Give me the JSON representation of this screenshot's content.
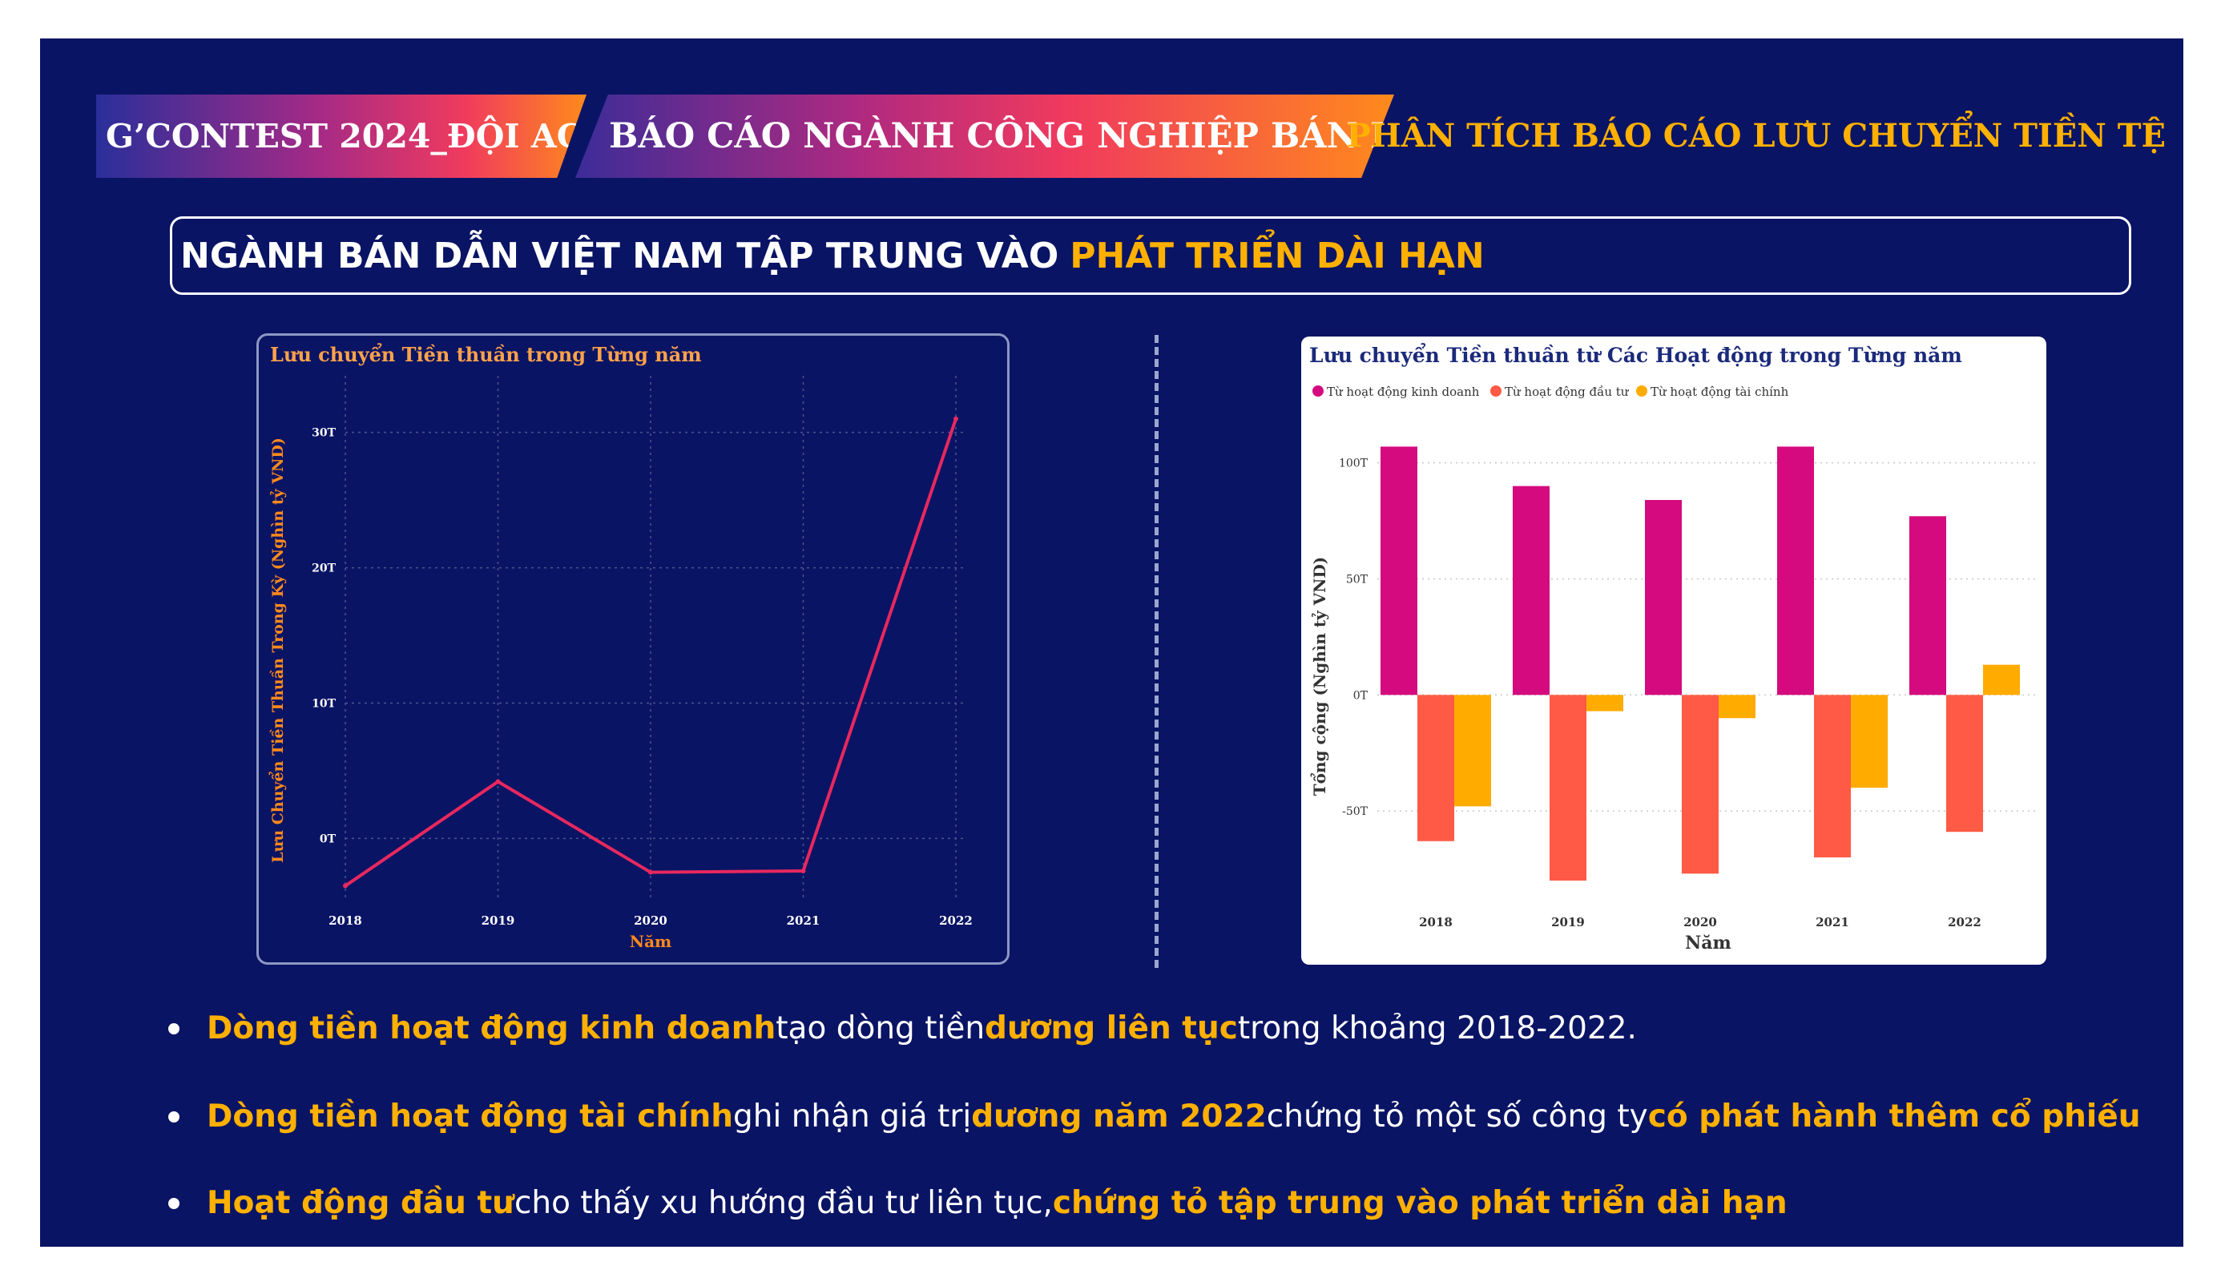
{
  "header": {
    "tag1": "G’CONTEST 2024_ĐỘI AC",
    "tag2": "BÁO CÁO NGÀNH CÔNG NGHIỆP BÁN DẪN",
    "section_title": "PHÂN TÍCH BÁO CÁO LƯU CHUYỂN TIỀN TỆ"
  },
  "headline": {
    "text": "NGÀNH BÁN DẪN VIỆT NAM TẬP TRUNG VÀO",
    "highlight": "PHÁT TRIỂN DÀI HẠN"
  },
  "colors": {
    "background": "#0a1464",
    "accent": "#ffb000",
    "line": "#e8285f",
    "operating": "#d40a7e",
    "investing": "#ff5a45",
    "financing": "#ffab00"
  },
  "chart_data": [
    {
      "type": "line",
      "title": "Lưu chuyển Tiền thuần trong Từng năm",
      "xlabel": "Năm",
      "ylabel": "Lưu Chuyển Tiền Thuần Trong Kỳ (Nghìn tỷ VND)",
      "x": [
        "2018",
        "2019",
        "2020",
        "2021",
        "2022"
      ],
      "y": [
        -3.5,
        4.2,
        -2.5,
        -2.4,
        31
      ],
      "y_ticks": [
        "0T",
        "10T",
        "20T",
        "30T"
      ],
      "y_tick_values": [
        0,
        10,
        20,
        30
      ],
      "ylim": [
        -4,
        33
      ],
      "grid": true
    },
    {
      "type": "bar",
      "title": "Lưu chuyển Tiền thuần từ Các Hoạt động trong Từng năm",
      "xlabel": "Năm",
      "ylabel": "Tổng cộng (Nghìn tỷ VND)",
      "categories": [
        "2018",
        "2019",
        "2020",
        "2021",
        "2022"
      ],
      "series": [
        {
          "name": "Từ hoạt động kinh doanh",
          "values": [
            107,
            90,
            84,
            107,
            77
          ]
        },
        {
          "name": "Từ hoạt động đầu tư",
          "values": [
            -63,
            -80,
            -77,
            -70,
            -59
          ]
        },
        {
          "name": "Từ hoạt động tài chính",
          "values": [
            -48,
            -7,
            -10,
            -40,
            13
          ]
        }
      ],
      "y_ticks": [
        "-50T",
        "0T",
        "50T",
        "100T"
      ],
      "y_tick_values": [
        -50,
        0,
        50,
        100
      ],
      "ylim": [
        -90,
        113
      ],
      "legend": "top-left",
      "grid": true
    }
  ],
  "bullets": [
    [
      {
        "text": "Dòng tiền hoạt động kinh doanh",
        "bold": true
      },
      {
        "text": " tạo dòng tiền ",
        "bold": false
      },
      {
        "text": "dương liên tục",
        "bold": true
      },
      {
        "text": " trong khoảng 2018-2022.",
        "bold": false
      }
    ],
    [
      {
        "text": "Dòng tiền hoạt động tài chính",
        "bold": true
      },
      {
        "text": " ghi nhận giá trị ",
        "bold": false
      },
      {
        "text": "dương năm 2022",
        "bold": true
      },
      {
        "text": " chứng tỏ một số công ty ",
        "bold": false
      },
      {
        "text": "có phát hành thêm cổ phiếu",
        "bold": true
      }
    ],
    [
      {
        "text": "Hoạt động đầu tư",
        "bold": true
      },
      {
        "text": " cho thấy xu hướng đầu tư liên tục, ",
        "bold": false
      },
      {
        "text": "chứng tỏ tập trung vào phát triển dài hạn",
        "bold": true
      }
    ]
  ]
}
